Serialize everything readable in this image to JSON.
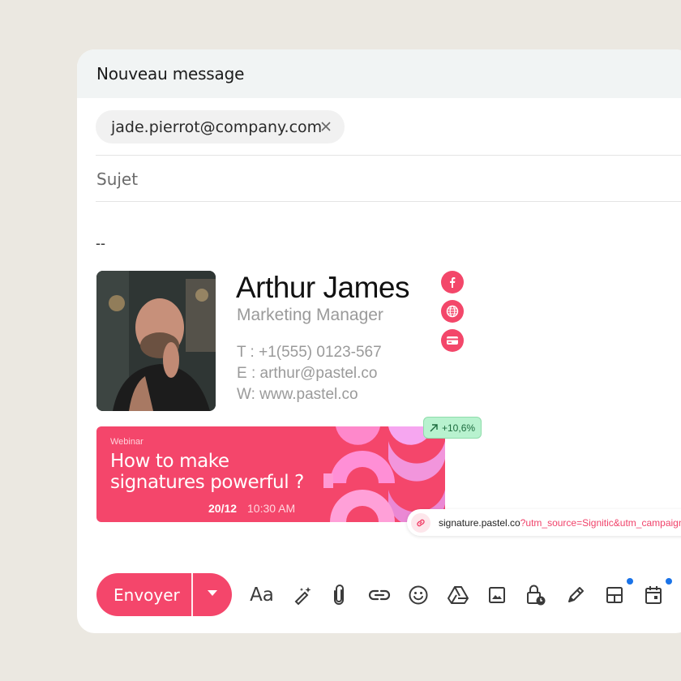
{
  "window": {
    "title": "Nouveau message"
  },
  "recipient": {
    "email": "jade.pierrot@company.com"
  },
  "subject": {
    "placeholder": "Sujet"
  },
  "body": {
    "separator": "--"
  },
  "signature": {
    "name": "Arthur James",
    "role": "Marketing Manager",
    "phone": "T : +1(555) 0123-567",
    "email": "E : arthur@pastel.co",
    "website": "W: www.pastel.co",
    "social_icons": [
      "facebook-icon",
      "globe-icon",
      "card-icon"
    ]
  },
  "banner": {
    "tag": "Webinar",
    "headline_line1": "How to make",
    "headline_line2": "signatures powerful ?",
    "date": "20/12",
    "time": "10:30 AM"
  },
  "stat_badge": {
    "label": "+10,6%"
  },
  "tracking_link": {
    "host": "signature.pastel.co",
    "params": "?utm_source=Signitic&utm_campaign"
  },
  "toolbar": {
    "send_label": "Envoyer",
    "format_label": "Aa",
    "icons": [
      "text-format-icon",
      "magic-pen-icon",
      "attach-icon",
      "link-icon",
      "emoji-icon",
      "drive-icon",
      "image-icon",
      "confidential-lock-icon",
      "signature-pen-icon",
      "layout-icon",
      "calendar-icon"
    ]
  },
  "colors": {
    "accent": "#f4466b",
    "background": "#ebe8e1",
    "badge": "#b8f2cf",
    "notification_dot": "#1a73e8"
  }
}
